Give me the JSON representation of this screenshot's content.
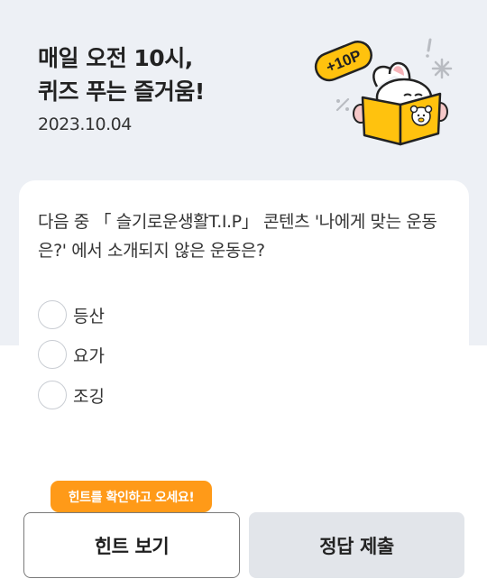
{
  "header": {
    "title_line1": "매일 오전 10시,",
    "title_line2": "퀴즈 푸는 즐거움!",
    "date": "2023.10.04",
    "badge": "+10P"
  },
  "quiz": {
    "question": "다음 중 「 슬기로운생활T.I.P」 콘텐츠 '나에게 맞는 운동은?' 에서 소개되지 않은 운동은?",
    "options": [
      "등산",
      "요가",
      "조깅"
    ]
  },
  "hint_tooltip": "힌트를 확인하고 오세요!",
  "buttons": {
    "hint": "힌트 보기",
    "submit": "정답 제출"
  },
  "colors": {
    "accent": "#ff9a18",
    "book_yellow": "#ffc20e",
    "header_bg": "#edf0f5"
  }
}
